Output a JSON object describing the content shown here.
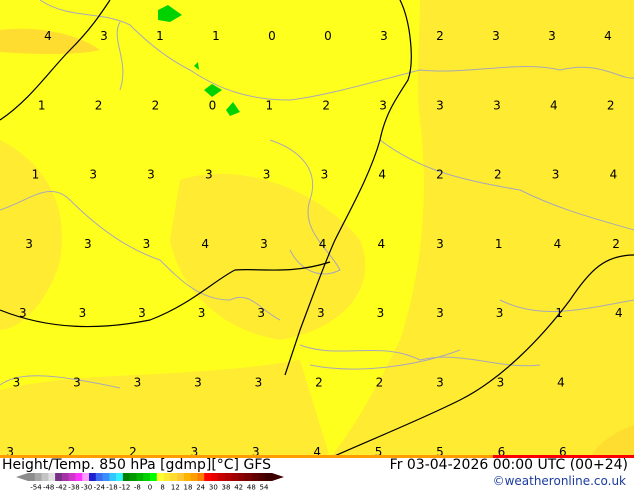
{
  "title": "Height/Temp. 850 hPa [gdmp][°C] GFS",
  "datetime": "Fr 03-04-2026 00:00 UTC (00+24)",
  "credit": "©weatheronline.co.uk",
  "colorbar": {
    "ticks": [
      "-54",
      "-48",
      "-42",
      "-38",
      "-30",
      "-24",
      "-18",
      "-12",
      "-8",
      "0",
      "8",
      "12",
      "18",
      "24",
      "30",
      "38",
      "42",
      "48",
      "54"
    ],
    "colors": [
      "#8c8c8c",
      "#a8a8a8",
      "#c4c4c4",
      "#e0e0e0",
      "#7a2f86",
      "#a432a6",
      "#cc37c8",
      "#ff32ff",
      "#ff9cff",
      "#2020d0",
      "#3a6cf0",
      "#3b8cff",
      "#32c8ff",
      "#32f0ff",
      "#008000",
      "#009a00",
      "#00b400",
      "#00d200",
      "#00ff00",
      "#ffff32",
      "#ffeb32",
      "#ffdc30",
      "#ffc832",
      "#ffb400",
      "#ff9c00",
      "#ff7c00",
      "#ff0000",
      "#e60000",
      "#c80000",
      "#b40000",
      "#a00000",
      "#8c0000",
      "#780000",
      "#640000",
      "#500000",
      "#3c0000"
    ]
  },
  "map_colors": {
    "base": "#ffff1e",
    "warm": "#ffeb32",
    "warmer": "#ffdc30",
    "green": "#00d200"
  },
  "temperature_labels": [
    [
      "4",
      "3",
      "1",
      "1",
      "0",
      "0",
      "3",
      "2",
      "3",
      "3",
      "4"
    ],
    [
      "1",
      "2",
      "2",
      "0",
      "1",
      "2",
      "3",
      "3",
      "3",
      "4",
      "2"
    ],
    [
      "1",
      "3",
      "3",
      "3",
      "3",
      "3",
      "4",
      "2",
      "2",
      "3",
      "4"
    ],
    [
      "3",
      "3",
      "3",
      "4",
      "3",
      "4",
      "4",
      "3",
      "1",
      "4",
      "2"
    ],
    [
      "3",
      "3",
      "3",
      "3",
      "3",
      "3",
      "3",
      "3",
      "3",
      "1",
      "4"
    ],
    [
      "3",
      "3",
      "3",
      "3",
      "3",
      "2",
      "2",
      "3",
      "3",
      "4"
    ],
    [
      "3",
      "2",
      "2",
      "3",
      "3",
      "4",
      "5",
      "5",
      "6",
      "6"
    ]
  ]
}
